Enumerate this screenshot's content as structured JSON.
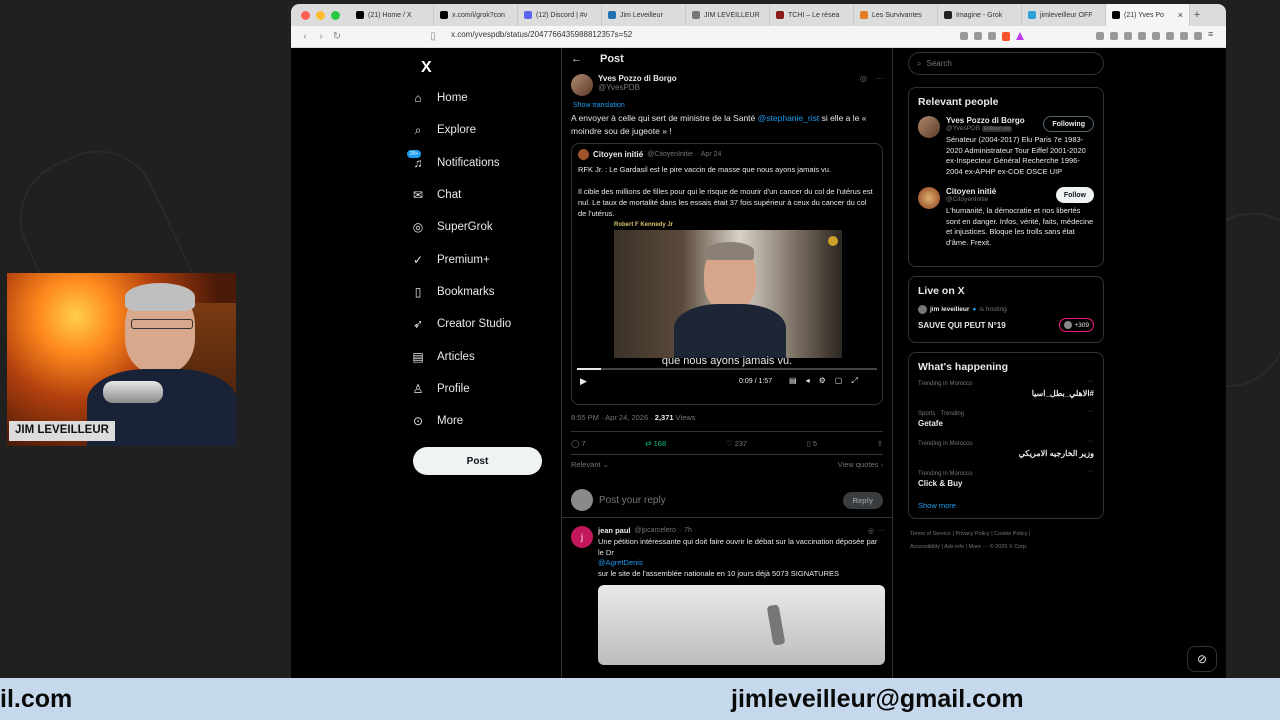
{
  "browser": {
    "tabs": [
      {
        "label": "(21) Home / X",
        "icon": "x-icon",
        "color": "#000000"
      },
      {
        "label": "x.com/i/grok?con",
        "icon": "x-icon",
        "color": "#000000"
      },
      {
        "label": "(12) Discord | #v",
        "icon": "discord-icon",
        "color": "#5865f2"
      },
      {
        "label": "Jim Leveilleur",
        "icon": "wordpress-icon",
        "color": "#2271b1"
      },
      {
        "label": "JIM LEVEILLEUR",
        "icon": "user-icon",
        "color": "#777777"
      },
      {
        "label": "TCHI – Le résea",
        "icon": "site-icon",
        "color": "#8b1a1a"
      },
      {
        "label": "Les Survivantes",
        "icon": "site-icon",
        "color": "#e67e22"
      },
      {
        "label": "Imagine - Grok",
        "icon": "grok-icon",
        "color": "#222222"
      },
      {
        "label": "jimleveilleur OFF",
        "icon": "telegram-icon",
        "color": "#2aa1da"
      },
      {
        "label": "(21) Yves Po",
        "icon": "x-icon",
        "color": "#000000"
      }
    ],
    "url": "x.com/yvespdb/status/2047766435988812357s=52"
  },
  "nav": {
    "logo": "X",
    "items": [
      {
        "label": "Home",
        "icon": "home-icon"
      },
      {
        "label": "Explore",
        "icon": "search-icon"
      },
      {
        "label": "Notifications",
        "icon": "bell-icon",
        "badge": "20+"
      },
      {
        "label": "Chat",
        "icon": "chat-icon"
      },
      {
        "label": "SuperGrok",
        "icon": "grok-icon"
      },
      {
        "label": "Premium+",
        "icon": "premium-icon"
      },
      {
        "label": "Bookmarks",
        "icon": "bookmark-icon"
      },
      {
        "label": "Creator Studio",
        "icon": "rocket-icon"
      },
      {
        "label": "Articles",
        "icon": "articles-icon"
      },
      {
        "label": "Profile",
        "icon": "profile-icon"
      },
      {
        "label": "More",
        "icon": "more-icon"
      }
    ],
    "post_button": "Post"
  },
  "post": {
    "header": "Post",
    "author": "Yves Pozzo di Borgo",
    "handle": "@YvesPDB",
    "show_translation": "Show translation",
    "text_before": "A envoyer à celle qui sert de ministre de la Santé ",
    "mention": "@stephanie_rist",
    "text_after": " si elle a le « moindre sou de jugeote » !",
    "quote": {
      "author": "Citoyen initié",
      "handle": "@CitoyenInitie",
      "date": "· Apr 24",
      "line1": "RFK Jr. : Le Gardasil est le pire vaccin de masse que nous ayons jamais vu.",
      "line2": "Il cible des millions de filles pour qui le risque de mourir d'un cancer du col de l'utérus est nul. Le taux de mortalité dans les essais était 37 fois supérieur à ceux du cancer du col de l'utérus.",
      "video_label": "Robert F Kennedy Jr",
      "subtitle": "que nous ayons jamais vu.",
      "time": "0:09 / 1:57",
      "progress": 0.08
    },
    "timestamp": "8:55 PM · Apr 24, 2026 · ",
    "views_count": "2,371",
    "views_label": " Views",
    "replies": "7",
    "reposts": "168",
    "likes": "237",
    "bookmarks": "5",
    "sort": "Relevant",
    "view_quotes": "View quotes",
    "reply_placeholder": "Post your reply",
    "reply_button": "Reply"
  },
  "reply": {
    "initial": "j",
    "author": "jean paul",
    "handle": "@jpcarcelero",
    "time": "· 7h",
    "line1": "Une pétition intéressante qui doit faire ouvrir le débat sur la vaccination déposée par le Dr",
    "mention": "@AgretDenis",
    "line2": "sur le site de l'assemblée nationale en 10 jours déjà 5073 SIGNATURES"
  },
  "sidebar": {
    "search_placeholder": "Search",
    "relevant_title": "Relevant people",
    "people": [
      {
        "name": "Yves Pozzo di Borgo",
        "handle": "@YvesPDB",
        "follows": "Follows you",
        "button": "Following",
        "bio": "Sénateur (2004-2017) Elu Paris 7e 1983-2020 Administrateur Tour Eiffel 2001-2020 ex-Inspecteur Général Recherche 1996-2004 ex-APHP ex-COE OSCE UIP"
      },
      {
        "name": "Citoyen initié",
        "handle": "@CitoyenInitie",
        "follows": "",
        "button": "Follow",
        "bio": "L'humanité, la démocratie et nos libertés sont en danger. Infos, vérité, faits, médecine et injustices. Bloque les trolls sans état d'âme. Frexit."
      }
    ],
    "live_title": "Live on X",
    "live_host": "jim leveilleur",
    "live_is_hosting": "is hosting",
    "live_name": "SAUVE QUI PEUT N°19",
    "live_count": "+309",
    "happening_title": "What's happening",
    "trends": [
      {
        "context": "Trending in Morocco",
        "name": "#الاهلي_بطل_اسيا",
        "rtl": true
      },
      {
        "context": "Sports · Trending",
        "name": "Getafe",
        "rtl": false
      },
      {
        "context": "Trending in Morocco",
        "name": "وزير الخارجيه الامريكي",
        "rtl": true
      },
      {
        "context": "Trending in Morocco",
        "name": "Click & Buy",
        "rtl": false
      }
    ],
    "show_more": "Show more",
    "footer1": "Terms of Service  |  Privacy Policy  |  Cookie Policy  |",
    "footer2": "Accessibility  |  Ads info  |  More ···  © 2026 X Corp."
  },
  "webcam": {
    "name_label": "JIM LEVEILLEUR"
  },
  "banner": {
    "left_text": "il.com",
    "right_text": "jimleveilleur@gmail.com"
  },
  "colors": {
    "accent": "#1d9bf0",
    "repost": "#00ba7c",
    "banner": "#c5d8ec"
  }
}
